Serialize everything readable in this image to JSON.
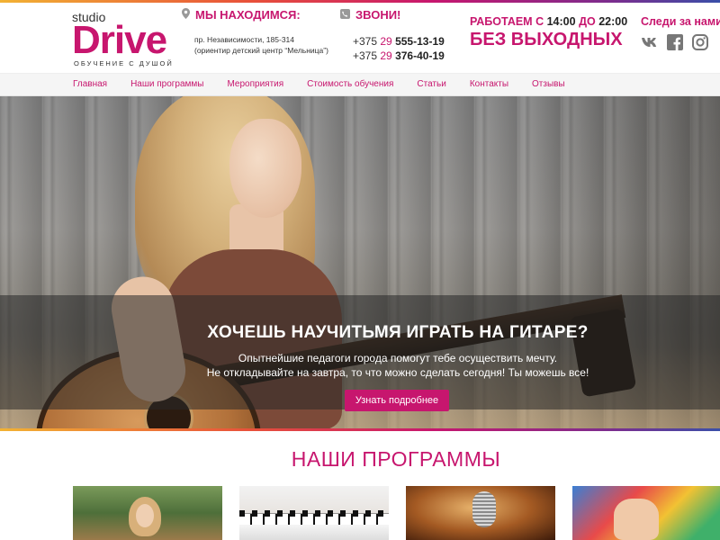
{
  "logo": {
    "studio": "studio",
    "name": "Drive",
    "slogan": "ОБУЧЕНИЕ С ДУШОЙ"
  },
  "location": {
    "title": "МЫ НАХОДИМСЯ:",
    "line1": "пр. Независимости, 185-314",
    "line2": "(ориентир детский центр “Мельница”)"
  },
  "call": {
    "title": "ЗВОНИ!",
    "phones": [
      {
        "prefix": "+375",
        "code": "29",
        "number": "555-13-19"
      },
      {
        "prefix": "+375",
        "code": "29",
        "number": "376-40-19"
      }
    ]
  },
  "hours": {
    "prefix": "РАБОТАЕМ С",
    "from": "14:00",
    "mid": "ДО",
    "to": "22:00",
    "big": "БЕЗ ВЫХОДНЫХ"
  },
  "social": {
    "title": "Следи за нами:",
    "icons": [
      "vk-icon",
      "facebook-icon",
      "instagram-icon"
    ]
  },
  "nav": {
    "items": [
      {
        "label": "Главная"
      },
      {
        "label": "Наши программы"
      },
      {
        "label": "Мероприятия"
      },
      {
        "label": "Стоимость обучения"
      },
      {
        "label": "Статьи"
      },
      {
        "label": "Контакты"
      },
      {
        "label": "Отзывы"
      }
    ]
  },
  "hero": {
    "title": "ХОЧЕШЬ НАУЧИТЬМЯ ИГРАТЬ НА ГИТАРЕ?",
    "sub1": "Опытнейшие педагоги города помогут тебе осуществить мечту.",
    "sub2": "Не откладывайте на завтра, то что можно сделать сегодня! Ты можешь все!",
    "button": "Узнать подробнее"
  },
  "programs": {
    "title": "НАШИ ПРОГРАММЫ"
  },
  "colors": {
    "accent": "#c7166e",
    "nav_bg": "#f5f5f5"
  }
}
